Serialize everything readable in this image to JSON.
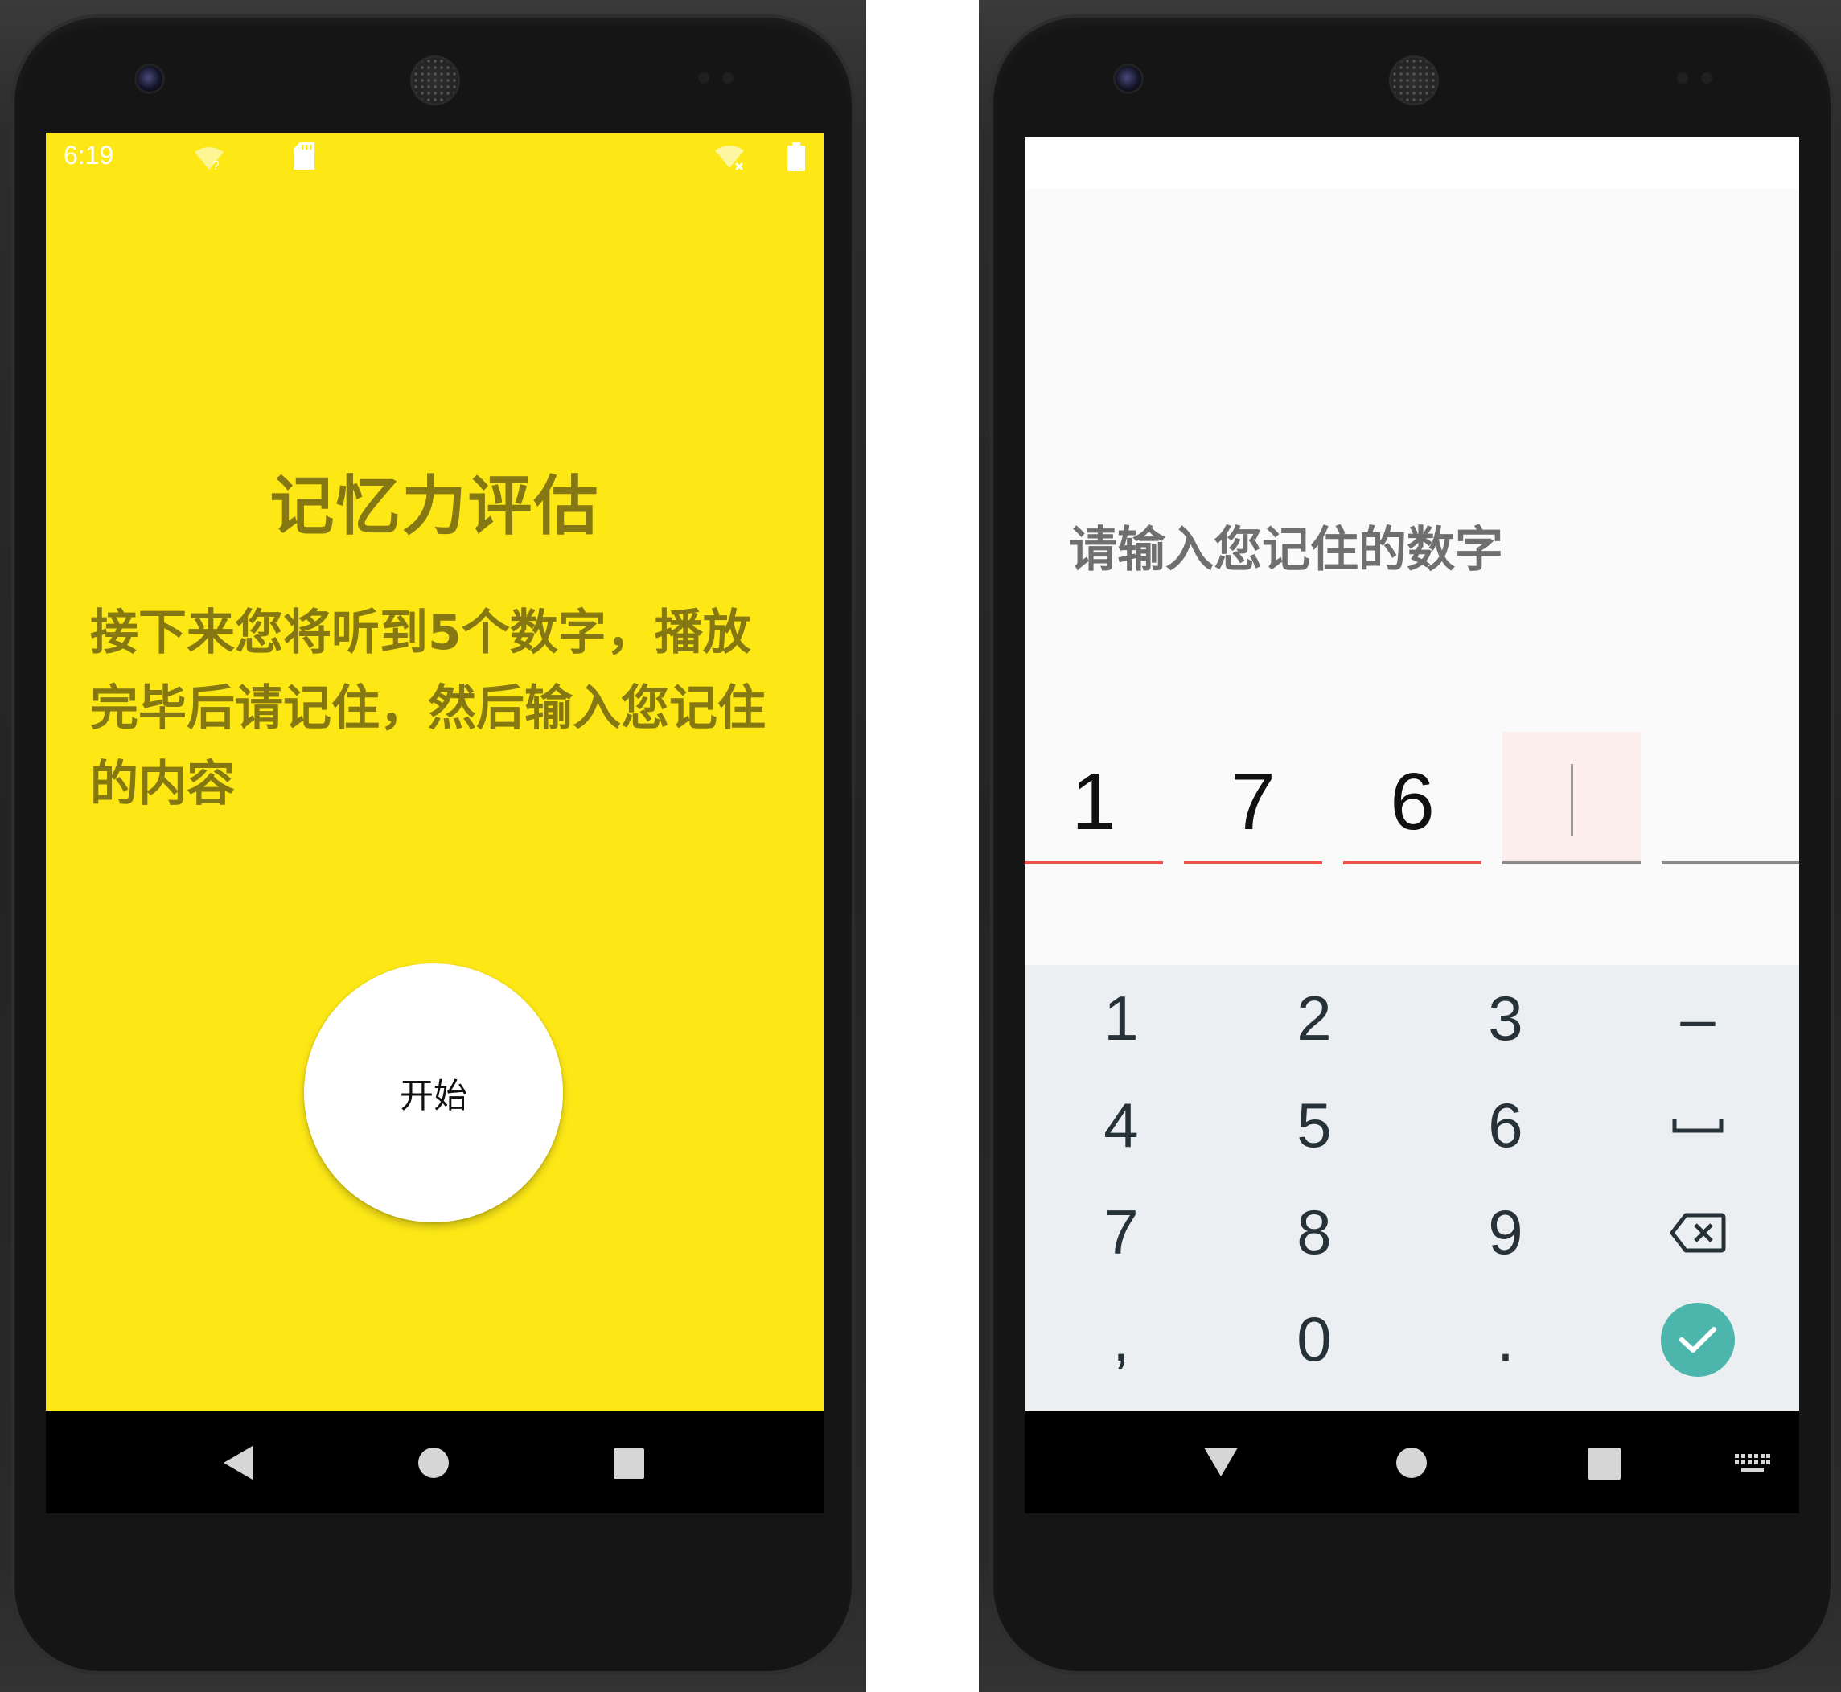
{
  "left_screen": {
    "status_bar": {
      "time": "6:19"
    },
    "title": "记忆力评估",
    "instructions": "接下来您将听到5个数字，播放完毕后请记住，然后输入您记住的内容",
    "start_button_label": "开始",
    "background_color": "#fde816",
    "text_color": "#857812"
  },
  "right_screen": {
    "prompt": "请输入您记住的数字",
    "digits": [
      "1",
      "7",
      "6",
      "",
      ""
    ],
    "filled_underline_color": "#ef5350",
    "empty_underline_color": "#8a8a8a",
    "keyboard": {
      "rows": [
        [
          "1",
          "2",
          "3",
          "–"
        ],
        [
          "4",
          "5",
          "6",
          "space-icon"
        ],
        [
          "7",
          "8",
          "9",
          "backspace-icon"
        ],
        [
          ",",
          "0",
          ".",
          "done-check-icon"
        ]
      ],
      "accent_color": "#4db6ac"
    }
  },
  "nav_left": [
    "back-icon",
    "home-icon",
    "recents-icon"
  ],
  "nav_right": [
    "back-down-icon",
    "home-icon",
    "recents-icon",
    "keyboard-switch-icon"
  ]
}
